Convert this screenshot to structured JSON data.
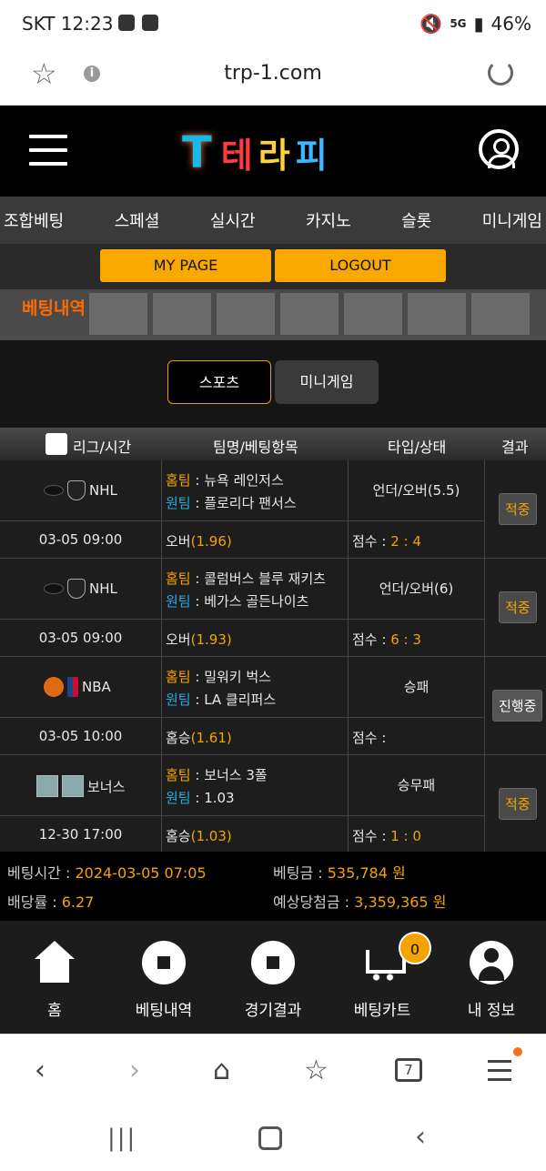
{
  "status": {
    "carrier_time": "SKT 12:23",
    "network": "5G",
    "battery": "46%"
  },
  "browser": {
    "url": "trp-1.com"
  },
  "site": {
    "logo_text": "테라피"
  },
  "nav": {
    "items": [
      "조합베팅",
      "스페셜",
      "실시간",
      "카지노",
      "슬롯",
      "미니게임"
    ]
  },
  "account": {
    "mypage": "MY PAGE",
    "logout": "LOGOUT"
  },
  "banner": {
    "title": "베팅내역"
  },
  "tabs": {
    "sports": "스포츠",
    "minigame": "미니게임"
  },
  "table": {
    "headers": {
      "league_time": "리그/시간",
      "team_bet": "팀명/베팅항목",
      "type_status": "타입/상태",
      "result": "결과"
    },
    "rows": [
      {
        "league": "NHL",
        "time": "03-05 09:00",
        "home_label": "홈팀",
        "home": "뉴욕 레인저스",
        "away_label": "원팀",
        "away": "플로리다 팬서스",
        "pick": "오버",
        "odds": "(1.96)",
        "bet_type": "언더/오버(5.5)",
        "score_label": "점수 :",
        "score": "2 : 4",
        "result": "적중"
      },
      {
        "league": "NHL",
        "time": "03-05 09:00",
        "home_label": "홈팀",
        "home": "콜럼버스 블루 재키츠",
        "away_label": "원팀",
        "away": "베가스 골든나이츠",
        "pick": "오버",
        "odds": "(1.93)",
        "bet_type": "언더/오버(6)",
        "score_label": "점수 :",
        "score": "6 : 3",
        "result": "적중"
      },
      {
        "league": "NBA",
        "time": "03-05 10:00",
        "home_label": "홈팀",
        "home": "밀워키 벅스",
        "away_label": "원팀",
        "away": "LA 클리퍼스",
        "pick": "홈승",
        "odds": "(1.61)",
        "bet_type": "승패",
        "score_label": "점수 :",
        "score": "",
        "result": "진행중"
      },
      {
        "league": "보너스",
        "time": "12-30 17:00",
        "home_label": "홈팀",
        "home": "보너스 3폴",
        "away_label": "원팀",
        "away": "1.03",
        "pick": "홈승",
        "odds": "(1.03)",
        "bet_type": "승무패",
        "score_label": "점수 :",
        "score": "1 : 0",
        "result": "적중"
      }
    ]
  },
  "summary": {
    "bet_time_label": "베팅시간 :",
    "bet_time": "2024-03-05 07:05",
    "bet_amount_label": "베팅금 :",
    "bet_amount": "535,784 원",
    "odds_label": "배당률 :",
    "odds": "6.27",
    "expected_label": "예상당첨금 :",
    "expected": "3,359,365 원"
  },
  "bottom_nav": {
    "home": "홈",
    "history": "베팅내역",
    "results": "경기결과",
    "cart": "베팅카트",
    "cart_count": "0",
    "myinfo": "내 정보"
  },
  "browser_bar": {
    "tab_count": "7"
  }
}
